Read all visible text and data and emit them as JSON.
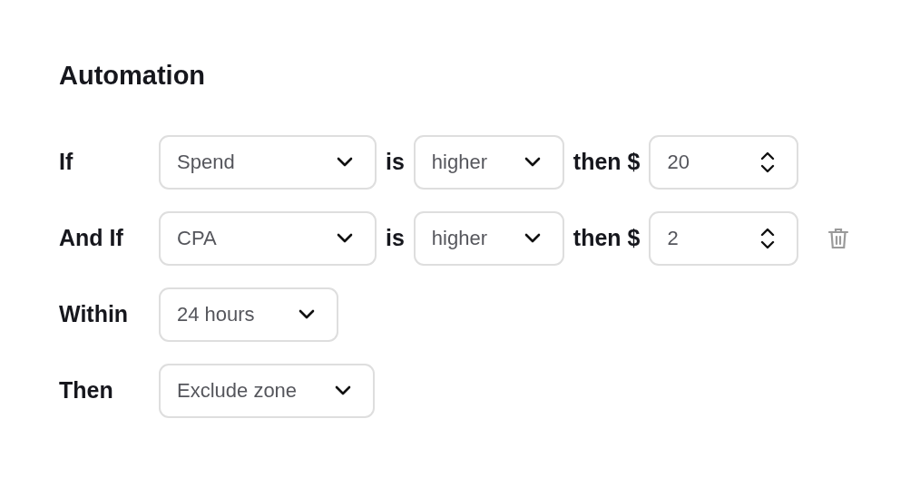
{
  "title": "Automation",
  "rows": [
    {
      "label": "If",
      "removable": false,
      "parts": [
        {
          "kind": "select",
          "value": "Spend"
        },
        {
          "kind": "word",
          "text": "is"
        },
        {
          "kind": "select",
          "value": "higher"
        },
        {
          "kind": "word",
          "text": "then $"
        },
        {
          "kind": "number",
          "value": "20"
        }
      ]
    },
    {
      "label": "And If",
      "removable": true,
      "parts": [
        {
          "kind": "select",
          "value": "CPA"
        },
        {
          "kind": "word",
          "text": "is"
        },
        {
          "kind": "select",
          "value": "higher"
        },
        {
          "kind": "word",
          "text": "then $"
        },
        {
          "kind": "number",
          "value": "2"
        }
      ]
    },
    {
      "label": "Within",
      "removable": false,
      "parts": [
        {
          "kind": "select",
          "value": "24 hours"
        }
      ]
    },
    {
      "label": "Then",
      "removable": false,
      "parts": [
        {
          "kind": "select",
          "value": "Exclude zone"
        }
      ]
    }
  ]
}
